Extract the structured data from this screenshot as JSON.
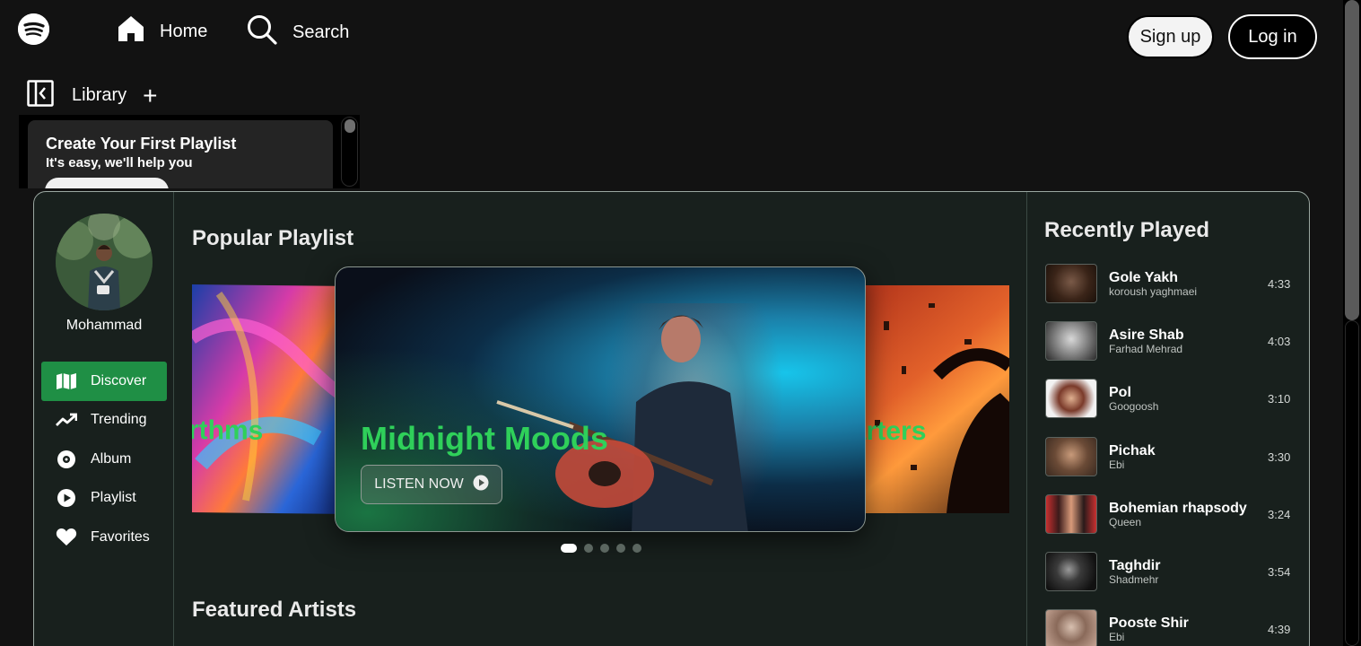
{
  "header": {
    "home_label": "Home",
    "search_label": "Search",
    "signup_label": "Sign up",
    "login_label": "Log in"
  },
  "library": {
    "label": "Library",
    "plus": "+",
    "card_title": "Create Your First Playlist",
    "card_subtitle": "It's easy, we'll help you"
  },
  "sidebar": {
    "user_name": "Mohammad",
    "items": [
      {
        "label": "Discover",
        "icon": "map-icon",
        "active": true
      },
      {
        "label": "Trending",
        "icon": "trending-icon",
        "active": false
      },
      {
        "label": "Album",
        "icon": "disc-icon",
        "active": false
      },
      {
        "label": "Playlist",
        "icon": "play-circle-icon",
        "active": false
      },
      {
        "label": "Favorites",
        "icon": "heart-icon",
        "active": false
      }
    ]
  },
  "main": {
    "popular_title": "Popular Playlist",
    "featured_title": "Featured Artists",
    "carousel": {
      "left_partial": "rthms",
      "right_partial": "arters",
      "main_title": "Midnight Moods",
      "listen_label": "LISTEN NOW",
      "active_index": 0,
      "dot_count": 5
    }
  },
  "recent": {
    "title": "Recently Played",
    "items": [
      {
        "song": "Gole Yakh",
        "artist": "koroush yaghmaei",
        "time": "4:33"
      },
      {
        "song": "Asire Shab",
        "artist": "Farhad Mehrad",
        "time": "4:03"
      },
      {
        "song": "Pol",
        "artist": "Googoosh",
        "time": "3:10"
      },
      {
        "song": "Pichak",
        "artist": "Ebi",
        "time": "3:30"
      },
      {
        "song": "Bohemian rhapsody",
        "artist": "Queen",
        "time": "3:24"
      },
      {
        "song": "Taghdir",
        "artist": "Shadmehr",
        "time": "3:54"
      },
      {
        "song": "Pooste Shir",
        "artist": "Ebi",
        "time": "4:39"
      }
    ]
  },
  "colors": {
    "accent": "#1f8f45",
    "title_green": "#2fd05a",
    "background": "#121212",
    "panel": "#18201d"
  }
}
